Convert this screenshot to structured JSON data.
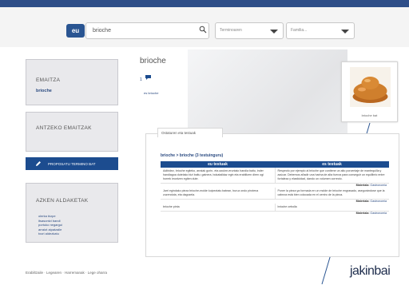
{
  "search": {
    "lang_badge": "eu",
    "query": "brioche",
    "select_1": "Terminoaren",
    "select_2": "Familia..."
  },
  "sidebar": {
    "box1_title": "EMAITZA",
    "box1_word": "brioche",
    "box2_title": "ANTZEKO EMAITZAK",
    "button_label": "PROPOSATU TERMINO BAT",
    "box3_title": "AZKEN ALDAKETAK",
    "recent_items": [
      "olerka bizpe",
      "itsasontzi bandi",
      "portuko negargui",
      "arraiot aipatzaile",
      "txori aldezkatu"
    ]
  },
  "entry": {
    "headword": "brioche",
    "number": "1",
    "small_link": "es brioche",
    "image_caption": "brioche bat"
  },
  "examples": {
    "tab_label": "Ostaturen eta testuak",
    "breadcrumb": "brioche > brioche (3 testuinguru)",
    "col_eu": "eu testuak",
    "col_es": "es testuak",
    "rows": [
      {
        "eu": "Adibidez, brioche egiteko, arraiak gurin- eta azukre-eruntaio handia baitu, inder handiagoa dutelako bizi baitu; gainera, bokataildaz egin eta erabiltzen diren ogi horrek leuntzen egiten dute.",
        "es": "Respecto por ejemplo al brioche que contiene un alto porcentaje de mantequilla y azúcar. Debemos añadir una harina de alta fuerza para conseguir un equilibrio entre fortaleza y elasticidad, dando un volumen correcto.",
        "source_label": "Materiala:",
        "source": "Gastronomia"
      },
      {
        "eu": "Jarri egindako pieza brioche-molde koipeztatu batean, buruz ondo pirotena zuzenduta, eta dagozela.",
        "es": "Poner la pieza ya formada en un molde de brioche engrasado, asegurándose que la cabeza está bien colocada en el centro de la pieza.",
        "source_label": "Materiala:",
        "source": "Gastronomia"
      },
      {
        "eu": "brioche pinta",
        "es": "brioche cebolla",
        "source_label": "Materiala:",
        "source": "Gastronomia"
      }
    ]
  },
  "footer": {
    "links": "Erabiltzaile · Legearen · Harremanak · Lege oharra",
    "brand": "jakinbai"
  }
}
